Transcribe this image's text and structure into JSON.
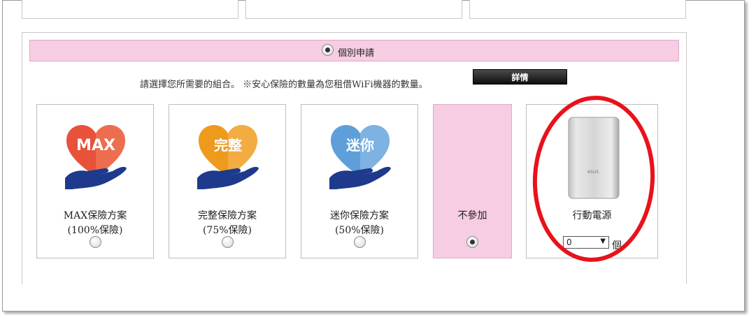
{
  "apply_bar": {
    "label": "個別申請",
    "selected": true
  },
  "intro": {
    "text": "請選擇您所需要的組合。 ※安心保險的數量為您租借WiFi機器的數量。"
  },
  "detail_button": {
    "label": "詳情"
  },
  "plans": [
    {
      "heart_text": "MAX",
      "name": "MAX保險方案",
      "coverage": "(100%保險)",
      "selected": false
    },
    {
      "heart_text": "完整",
      "name": "完整保險方案",
      "coverage": "(75%保險)",
      "selected": false
    },
    {
      "heart_text": "迷你",
      "name": "迷你保險方案",
      "coverage": "(50%保險)",
      "selected": false
    }
  ],
  "no_join": {
    "label": "不參加",
    "selected": true
  },
  "power_bank": {
    "name": "行動電源",
    "brand": "ASUS",
    "quantity": "0",
    "unit": "個"
  },
  "colors": {
    "pink": "#f6cde2",
    "max_heart": "#e8513a",
    "full_heart": "#ee9a1c",
    "mini_heart": "#5f9fd9",
    "hand": "#1d3a8c",
    "highlight": "#e8121b"
  }
}
